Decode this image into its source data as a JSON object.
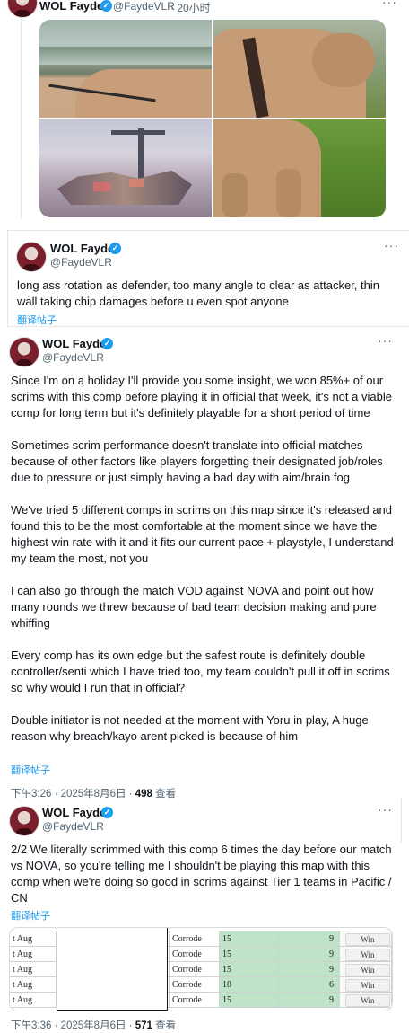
{
  "tweets": [
    {
      "name": "WOL Fayde",
      "handle": "@FaydeVLR",
      "time": "· 20小时",
      "more": "···"
    },
    {
      "name": "WOL Fayde",
      "handle": "@FaydeVLR",
      "more": "···",
      "text": "long ass rotation as defender, too many angle to clear as attacker, thin wall taking chip damages before u even spot anyone",
      "translate": "翻译帖子"
    },
    {
      "name": "WOL Fayde",
      "handle": "@FaydeVLR",
      "more": "···",
      "paragraphs": [
        "Since I'm on a holiday I'll provide you some insight, we won 85%+ of our scrims with this comp before playing it in official that week, it's not a viable comp for long term but it's definitely playable for a short period of time",
        "Sometimes scrim performance doesn't translate into official matches because of other factors like players forgetting their designated job/roles due to pressure or just simply having a bad day with aim/brain fog",
        "We've tried 5 different comps in scrims on this map since it's released and found this to be the most comfortable at the moment since we have the highest win rate with it and it fits our current pace + playstyle, I understand my team the most, not you",
        "I can also go through the match VOD against NOVA and point out how many rounds we threw because of bad team decision making and pure whiffing",
        "Every comp has its own edge but the safest route is definitely double controller/senti which I have tried too, my team couldn't pull it off in scrims so why would I run that in official?",
        "Double initiator is not needed at the moment with Yoru in play, A huge reason why breach/kayo arent picked is because of him"
      ],
      "translate": "翻译帖子",
      "timestamp": "下午3:26 · 2025年8月6日 · ",
      "views": "498",
      "views_label": " 查看"
    },
    {
      "name": "WOL Fayde",
      "handle": "@FaydeVLR",
      "more": "···",
      "text": "2/2 We literally scrimmed with this comp 6 times the day before our match vs NOVA, so you're telling me I shouldn't be playing this map with this comp when we're doing so good in scrims against Tier 1 teams in Pacific / CN",
      "translate": "翻译帖子",
      "timestamp": "下午3:36 · 2025年8月6日 · ",
      "views": "571",
      "views_label": " 查看"
    }
  ],
  "scrim_table": {
    "rows": [
      {
        "date": "t Aug",
        "map": "Corrode",
        "a": "15",
        "b": "9",
        "result": "Win"
      },
      {
        "date": "t Aug",
        "map": "Corrode",
        "a": "15",
        "b": "9",
        "result": "Win"
      },
      {
        "date": "t Aug",
        "map": "Corrode",
        "a": "15",
        "b": "9",
        "result": "Win"
      },
      {
        "date": "t Aug",
        "map": "Corrode",
        "a": "18",
        "b": "6",
        "result": "Win"
      },
      {
        "date": "t Aug",
        "map": "Corrode",
        "a": "15",
        "b": "9",
        "result": "Win"
      }
    ]
  },
  "colors": {
    "accent": "#1d9bf0",
    "score_fill": "#bfe3c9"
  }
}
